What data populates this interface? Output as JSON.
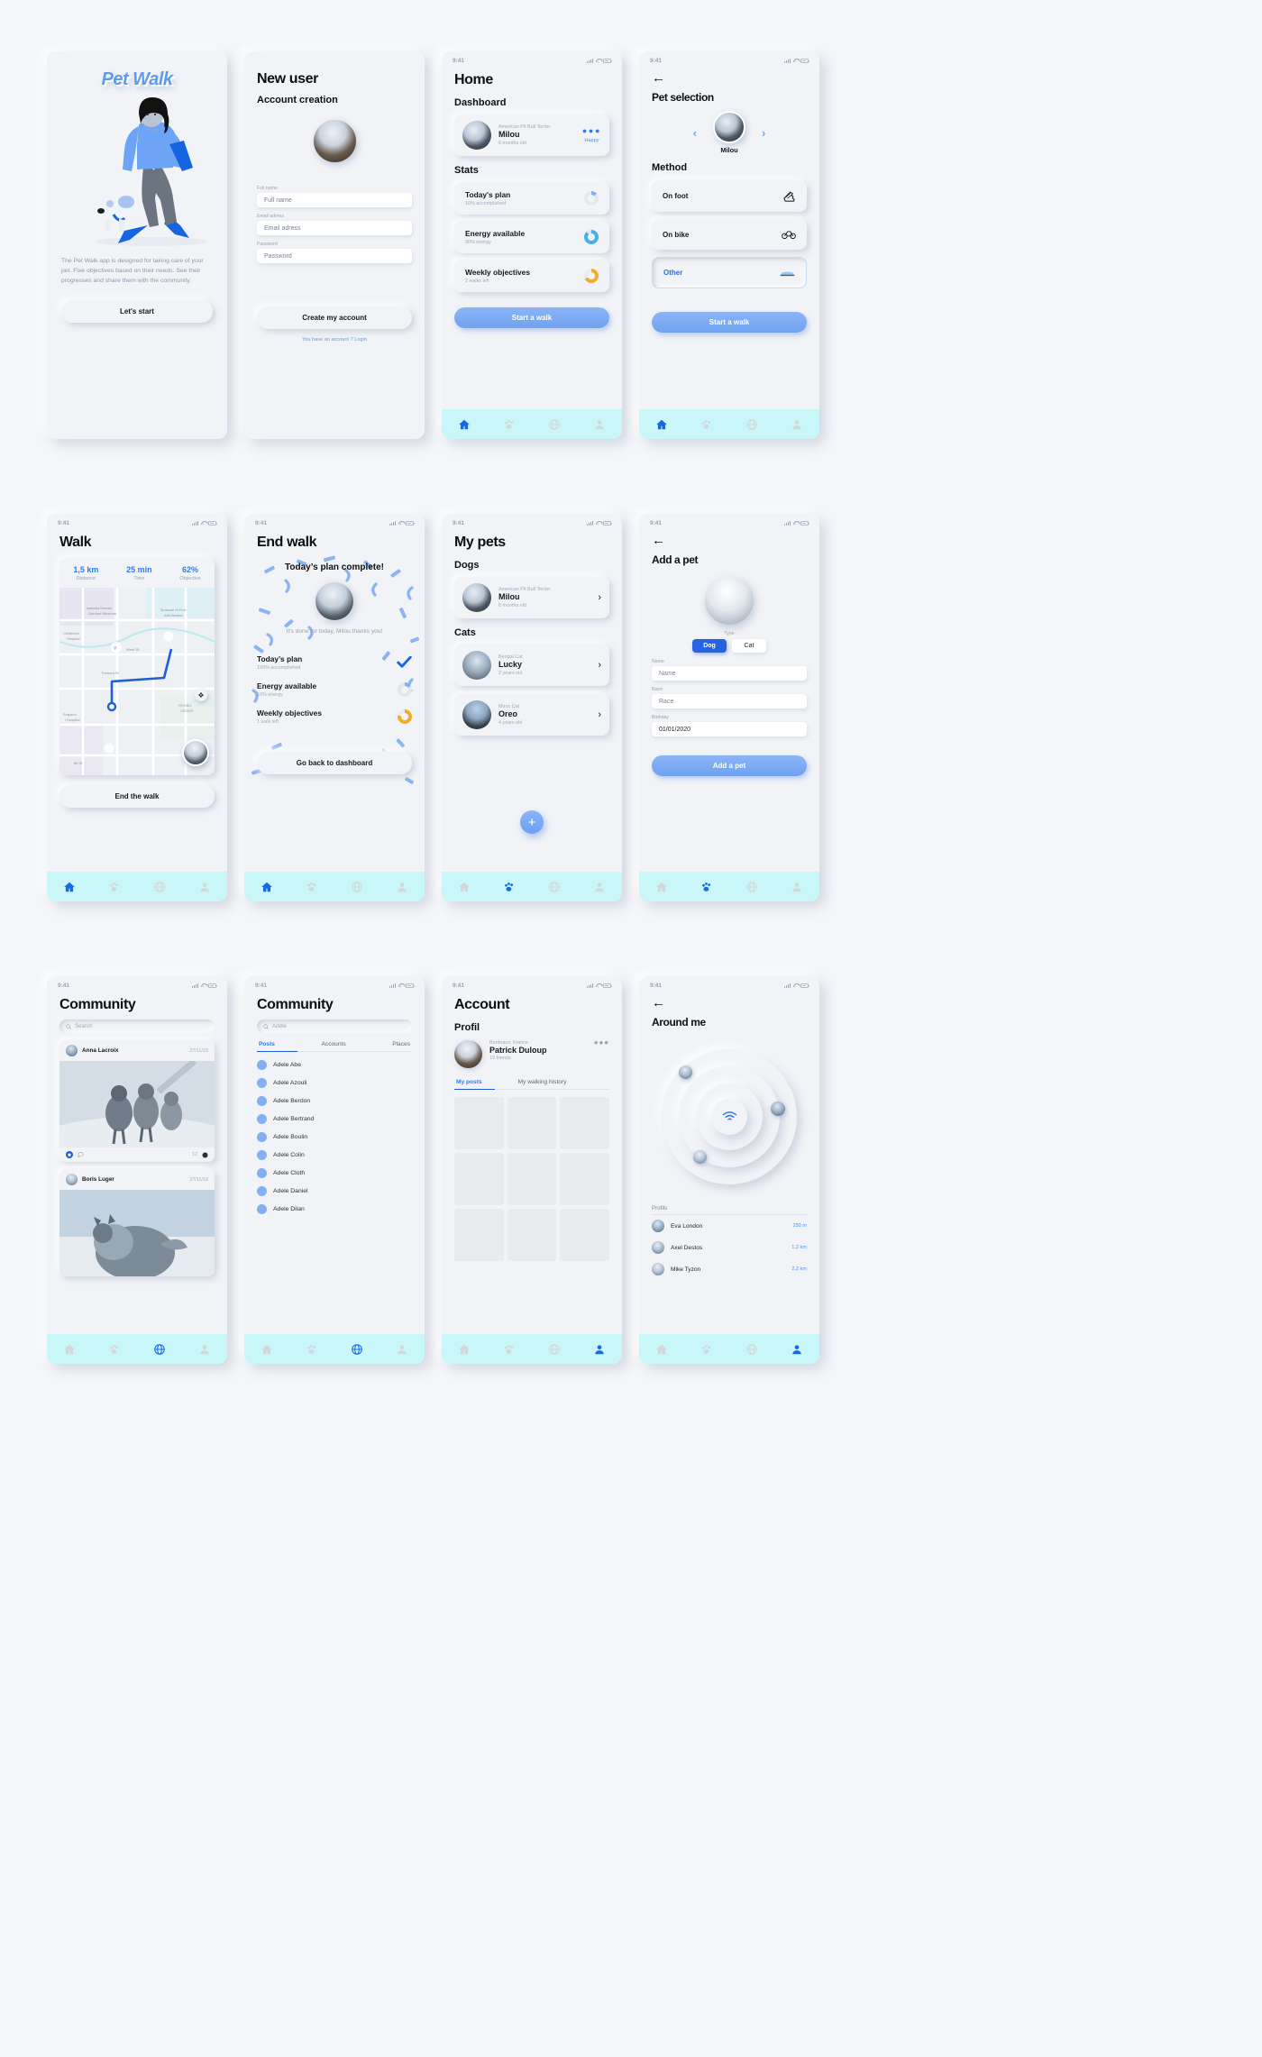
{
  "status_bar": {
    "time": "9:41"
  },
  "screens": [
    {
      "id": "onboarding",
      "logo": "Pet Walk",
      "description": "The Pet Walk app is designed for taking care of your pet. Fixe objectives based on their needs. See their progresses and share them with the community.",
      "cta": "Let's start"
    },
    {
      "id": "new-user",
      "title": "New user",
      "subtitle": "Account creation",
      "fields": [
        {
          "label": "Full name",
          "placeholder": "Full name",
          "value": ""
        },
        {
          "label": "Email adress",
          "placeholder": "Email adress",
          "value": ""
        },
        {
          "label": "Password",
          "placeholder": "Password",
          "value": ""
        }
      ],
      "cta": "Create my account",
      "login_link": "You have an account ? Login"
    },
    {
      "id": "home",
      "title": "Home",
      "dashboard_label": "Dashboard",
      "pet": {
        "breed": "American Pit Bull Terrier",
        "name": "Milou",
        "age": "6 months old",
        "mood": "Happy"
      },
      "stats_label": "Stats",
      "stats": [
        {
          "title": "Today's plan",
          "sub": "10% accomplished",
          "percent": 10,
          "color": "#7fb0f2"
        },
        {
          "title": "Energy available",
          "sub": "90% energy",
          "percent": 90,
          "color": "#46aeeb"
        },
        {
          "title": "Weekly objectives",
          "sub": "2 walks left",
          "percent": 66,
          "color": "#f0ad2b"
        }
      ],
      "cta": "Start a walk",
      "active_tab": "home"
    },
    {
      "id": "pet-selection",
      "title": "Pet selection",
      "pet_name": "Milou",
      "method_label": "Method",
      "methods": [
        {
          "label": "On foot",
          "icon": "shoe-icon",
          "selected": false
        },
        {
          "label": "On bike",
          "icon": "bike-icon",
          "selected": false
        },
        {
          "label": "Other",
          "icon": "car-icon",
          "selected": true
        }
      ],
      "cta": "Start a walk",
      "active_tab": "home"
    },
    {
      "id": "walk",
      "title": "Walk",
      "stats": [
        {
          "value": "1,5 km",
          "label": "Distance"
        },
        {
          "value": "25 min",
          "label": "Time"
        },
        {
          "value": "62%",
          "label": "Objective"
        }
      ],
      "cta": "End the walk",
      "active_tab": "home"
    },
    {
      "id": "end-walk",
      "title": "End walk",
      "headline": "Today’s plan complete!",
      "thanks": "It's done for today, Milou thanks you!",
      "rows": [
        {
          "title": "Today’s plan",
          "sub": "100% accomplished",
          "indicator": "check",
          "percent": 100,
          "color": "#1567e8"
        },
        {
          "title": "Energy available",
          "sub": "10% energy",
          "indicator": "ring",
          "percent": 15,
          "color": "#7fb0f2"
        },
        {
          "title": "Weekly objectives",
          "sub": "1 walk left",
          "indicator": "ring",
          "percent": 75,
          "color": "#f0ad2b"
        }
      ],
      "cta": "Go back to dashboard",
      "active_tab": "home"
    },
    {
      "id": "my-pets",
      "title": "My pets",
      "groups": [
        {
          "label": "Dogs",
          "pets": [
            {
              "breed": "American Pit Bull Terrier",
              "name": "Milou",
              "age": "6 months old",
              "photo": "ph-dog"
            }
          ]
        },
        {
          "label": "Cats",
          "pets": [
            {
              "breed": "Bengal Cat",
              "name": "Lucky",
              "age": "2 years old",
              "photo": "ph-cat1"
            },
            {
              "breed": "Manx Cat",
              "name": "Oreo",
              "age": "4 years old",
              "photo": "ph-cat2"
            }
          ]
        }
      ],
      "fab": "+",
      "active_tab": "pets"
    },
    {
      "id": "add-pet",
      "title": "Add a pet",
      "type_label": "Type",
      "types": [
        {
          "label": "Dog",
          "selected": true
        },
        {
          "label": "Cat",
          "selected": false
        }
      ],
      "fields": [
        {
          "label": "Name",
          "placeholder": "Name",
          "value": ""
        },
        {
          "label": "Race",
          "placeholder": "Race",
          "value": ""
        },
        {
          "label": "Birthday",
          "placeholder": "01/01/2020",
          "value": "01/01/2020"
        }
      ],
      "cta": "Add a pet",
      "active_tab": "pets"
    },
    {
      "id": "community-feed",
      "title": "Community",
      "search_placeholder": "Search",
      "search_value": "",
      "posts": [
        {
          "author": "Anna Lacroix",
          "date": "27/11/19",
          "likes": "12",
          "photo": "dogs-on-leash"
        },
        {
          "author": "Boris Luger",
          "date": "27/11/19",
          "likes": "",
          "photo": "husky-walk"
        }
      ],
      "active_tab": "community"
    },
    {
      "id": "community-search",
      "title": "Community",
      "search_value": "Adele",
      "search_placeholder": "Search",
      "tabs": [
        {
          "label": "Posts",
          "active": true
        },
        {
          "label": "Accounts",
          "active": false
        },
        {
          "label": "Places",
          "active": false
        }
      ],
      "results": [
        "Adele Abe",
        "Adele Azouli",
        "Adele Berdon",
        "Adele Bertrand",
        "Adele Boulin",
        "Adele Colin",
        "Adele Cloth",
        "Adele Daniel",
        "Adele Dilan"
      ],
      "active_tab": "community"
    },
    {
      "id": "account",
      "title": "Account",
      "profil_label": "Profil",
      "user": {
        "location": "Bordeaux, France",
        "name": "Patrick Duloup",
        "friends": "19 friends"
      },
      "tabs": [
        {
          "label": "My posts",
          "active": true
        },
        {
          "label": "My walking history",
          "active": false
        }
      ],
      "active_tab": "account"
    },
    {
      "id": "around-me",
      "title": "Around me",
      "profils_label": "Profils",
      "profiles": [
        {
          "name": "Eva London",
          "distance": "250 m",
          "photo": "ph-u1"
        },
        {
          "name": "Axel Destos",
          "distance": "1,2 km",
          "photo": "ph-u2"
        },
        {
          "name": "Mike Tyzon",
          "distance": "2,2 km",
          "photo": "ph-u3"
        }
      ],
      "active_tab": "account"
    }
  ],
  "colors": {
    "accent_blue": "#2e7df0",
    "light_blue": "#8cb5f7",
    "tabbar": "#c9f6f8",
    "orange": "#f0ad2b",
    "bg": "#f1f3f7"
  }
}
